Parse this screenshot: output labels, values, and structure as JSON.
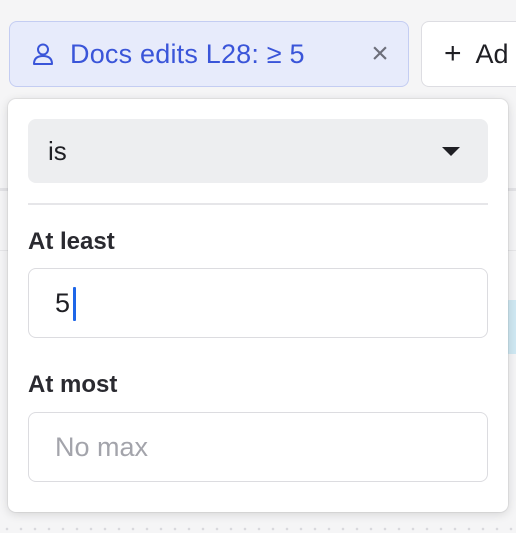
{
  "chip": {
    "icon": "person-icon",
    "label": "Docs edits L28: ≥ 5",
    "close_symbol": "×",
    "accent_color": "#3a55d9"
  },
  "add_button": {
    "icon": "plus-icon",
    "symbol": "+",
    "label": "Ad"
  },
  "popover": {
    "operator_select": {
      "value": "is",
      "icon": "caret-down-icon"
    },
    "min": {
      "label": "At least",
      "value": "5",
      "placeholder": ""
    },
    "max": {
      "label": "At most",
      "value": "",
      "placeholder": "No max"
    }
  }
}
